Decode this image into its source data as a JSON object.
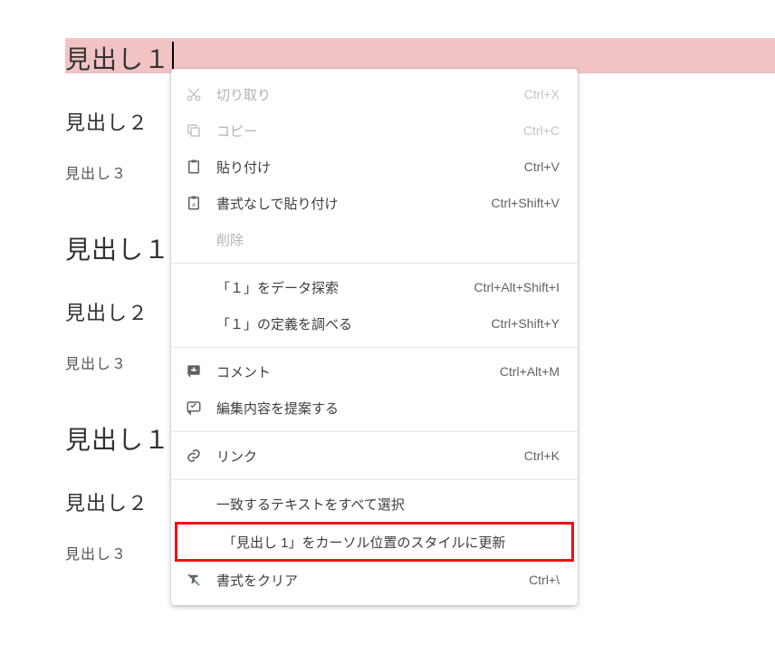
{
  "document": {
    "blocks": [
      {
        "h1": "見出し１",
        "h2": "見出し２",
        "h3": "見出し３"
      },
      {
        "h1": "見出し１",
        "h2": "見出し２",
        "h3": "見出し３"
      },
      {
        "h1": "見出し１",
        "h2": "見出し２",
        "h3": "見出し３"
      }
    ],
    "selected_text": "見出し１"
  },
  "context_menu": {
    "items": {
      "cut": {
        "label": "切り取り",
        "shortcut": "Ctrl+X",
        "enabled": false
      },
      "copy": {
        "label": "コピー",
        "shortcut": "Ctrl+C",
        "enabled": false
      },
      "paste": {
        "label": "貼り付け",
        "shortcut": "Ctrl+V",
        "enabled": true
      },
      "paste_plain": {
        "label": "書式なしで貼り付け",
        "shortcut": "Ctrl+Shift+V",
        "enabled": true
      },
      "delete": {
        "label": "削除",
        "shortcut": "",
        "enabled": false
      },
      "explore": {
        "label": "「１」をデータ探索",
        "shortcut": "Ctrl+Alt+Shift+I",
        "enabled": true
      },
      "define": {
        "label": "「１」の定義を調べる",
        "shortcut": "Ctrl+Shift+Y",
        "enabled": true
      },
      "comment": {
        "label": "コメント",
        "shortcut": "Ctrl+Alt+M",
        "enabled": true
      },
      "suggest": {
        "label": "編集内容を提案する",
        "shortcut": "",
        "enabled": true
      },
      "link": {
        "label": "リンク",
        "shortcut": "Ctrl+K",
        "enabled": true
      },
      "select_matching": {
        "label": "一致するテキストをすべて選択",
        "shortcut": "",
        "enabled": true
      },
      "update_style": {
        "label": "「見出し 1」をカーソル位置のスタイルに更新",
        "shortcut": "",
        "enabled": true
      },
      "clear_format": {
        "label": "書式をクリア",
        "shortcut": "Ctrl+\\",
        "enabled": true
      }
    },
    "highlighted_item": "update_style"
  }
}
